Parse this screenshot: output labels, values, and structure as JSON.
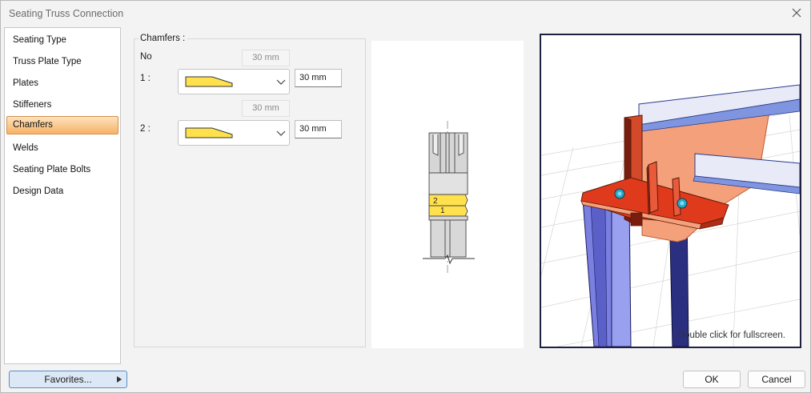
{
  "window": {
    "title": "Seating Truss Connection"
  },
  "sidebar": {
    "items": [
      {
        "label": "Seating Type"
      },
      {
        "label": "Truss Plate Type"
      },
      {
        "label": "Plates"
      },
      {
        "label": "Stiffeners"
      },
      {
        "label": "Chamfers",
        "selected": true
      },
      {
        "label": "Welds"
      },
      {
        "label": "Seating Plate Bolts"
      },
      {
        "label": "Design Data"
      }
    ]
  },
  "chamfers": {
    "group_title": "Chamfers :",
    "no_label": "No",
    "rows": [
      {
        "label": "1 :",
        "ghost_value": "30 mm",
        "value": "30 mm"
      },
      {
        "label": "2 :",
        "ghost_value": "30 mm",
        "value": "30 mm"
      }
    ]
  },
  "drawing": {
    "label_2": "2",
    "label_1": "1"
  },
  "viewer": {
    "hint": "Double click for fullscreen."
  },
  "buttons": {
    "favorites": "Favorites...",
    "ok": "OK",
    "cancel": "Cancel"
  },
  "colors": {
    "selection_fill": "#f6b266",
    "chamfer_fill": "#ffe14d",
    "plate_red": "#e03a1c",
    "truss_salmon": "#f4a07a",
    "column_blue": "#7a80e0"
  },
  "icons": {
    "close": "close-icon",
    "dropdown": "chevron-down-icon",
    "favorites_caret": "caret-right-icon"
  }
}
